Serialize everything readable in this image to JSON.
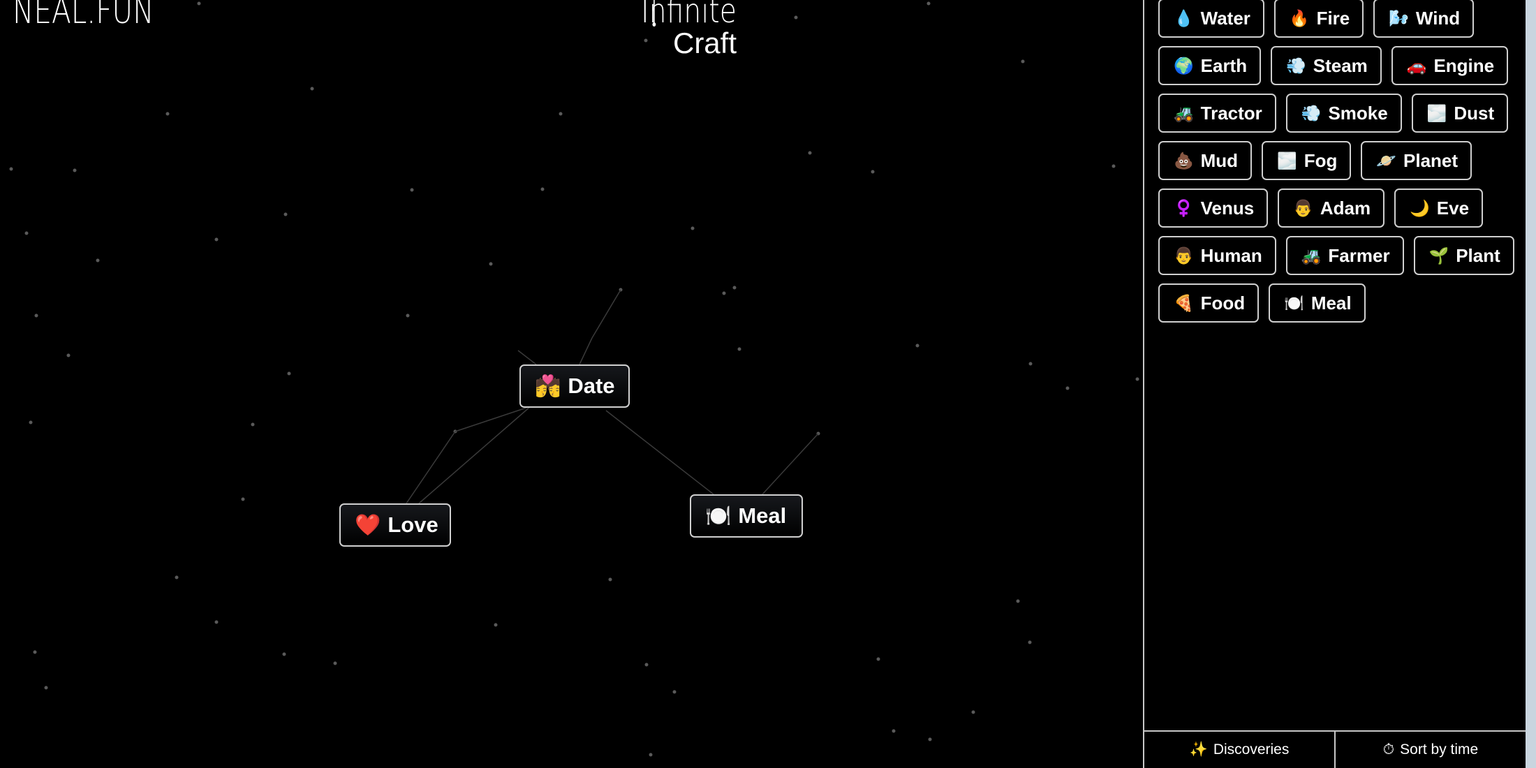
{
  "logo": "NEAL.FUN",
  "title": {
    "line1": "Infinite",
    "line2": "Craft"
  },
  "canvas": {
    "items": [
      {
        "emoji": "💏",
        "label": "Date",
        "icon": "couple-kiss-icon"
      },
      {
        "emoji": "❤️",
        "label": "Love",
        "icon": "red-heart-icon"
      },
      {
        "emoji": "🍽️",
        "label": "Meal",
        "icon": "plate-icon"
      }
    ]
  },
  "sidebar": {
    "items": [
      {
        "emoji": "💧",
        "label": "Water",
        "icon": "droplet-icon"
      },
      {
        "emoji": "🔥",
        "label": "Fire",
        "icon": "fire-icon"
      },
      {
        "emoji": "🌬️",
        "label": "Wind",
        "icon": "wind-face-icon"
      },
      {
        "emoji": "🌍",
        "label": "Earth",
        "icon": "globe-icon"
      },
      {
        "emoji": "💨",
        "label": "Steam",
        "icon": "dash-icon"
      },
      {
        "emoji": "🚗",
        "label": "Engine",
        "icon": "car-icon"
      },
      {
        "emoji": "🚜",
        "label": "Tractor",
        "icon": "tractor-icon"
      },
      {
        "emoji": "💨",
        "label": "Smoke",
        "icon": "dash-icon"
      },
      {
        "emoji": "🌫️",
        "label": "Dust",
        "icon": "fog-icon"
      },
      {
        "emoji": "💩",
        "label": "Mud",
        "icon": "pile-icon"
      },
      {
        "emoji": "🌫️",
        "label": "Fog",
        "icon": "fog-icon"
      },
      {
        "emoji": "🪐",
        "label": "Planet",
        "icon": "ringed-planet-icon"
      },
      {
        "emoji": "♀️",
        "label": "Venus",
        "icon": "female-sign-icon"
      },
      {
        "emoji": "👨",
        "label": "Adam",
        "icon": "man-icon"
      },
      {
        "emoji": "🌙",
        "label": "Eve",
        "icon": "crescent-moon-icon"
      },
      {
        "emoji": "👨",
        "label": "Human",
        "icon": "man-icon"
      },
      {
        "emoji": "🚜",
        "label": "Farmer",
        "icon": "tractor-icon"
      },
      {
        "emoji": "🌱",
        "label": "Plant",
        "icon": "seedling-icon"
      },
      {
        "emoji": "🍕",
        "label": "Food",
        "icon": "pizza-icon"
      },
      {
        "emoji": "🍽️",
        "label": "Meal",
        "icon": "plate-icon"
      }
    ],
    "footer": {
      "discoveries": {
        "icon": "✨",
        "label": "Discoveries"
      },
      "sort": {
        "icon": "⏱",
        "label": "Sort by time"
      }
    }
  }
}
